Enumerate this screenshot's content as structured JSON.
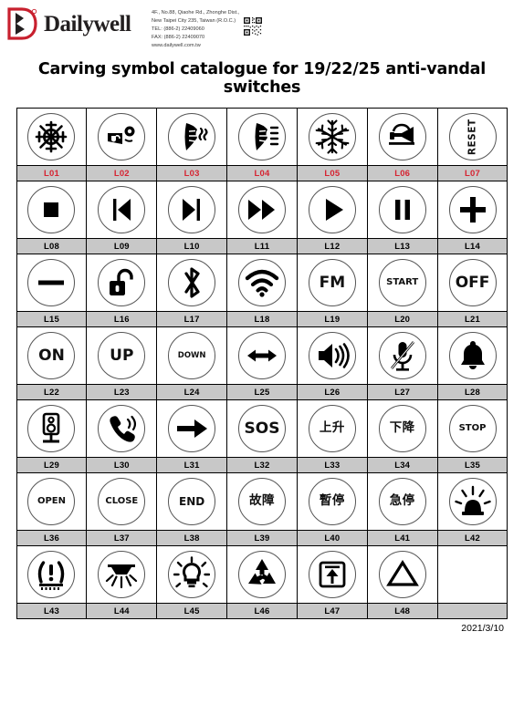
{
  "company": {
    "logo_name": "Dailywell",
    "address_lines": [
      "4F., No.88, Qiaohe Rd., Zhonghe Dist.,",
      "New Taipei City 235, Taiwan (R.O.C.)",
      "TEL: (886-2) 22409060",
      "FAX: (886-2) 22409070",
      "www.dailywell.com.tw"
    ]
  },
  "document": {
    "title": "Carving symbol catalogue for 19/22/25 anti-vandal switches",
    "date": "2021/3/10"
  },
  "colors": {
    "label_red": "#d62432",
    "label_black": "#000000",
    "label_row_bg": "#c8c8c8",
    "brand_red": "#c8202e"
  },
  "symbols": [
    {
      "code": "L01",
      "icon": "snowflake-ac-icon",
      "label_color": "red",
      "kind": "svg",
      "text": ""
    },
    {
      "code": "L02",
      "icon": "windshield-washer-icon",
      "label_color": "red",
      "kind": "svg",
      "text": ""
    },
    {
      "code": "L03",
      "icon": "rear-window-defroster-icon",
      "label_color": "red",
      "kind": "svg",
      "text": ""
    },
    {
      "code": "L04",
      "icon": "front-windshield-defroster-icon",
      "label_color": "red",
      "kind": "svg",
      "text": ""
    },
    {
      "code": "L05",
      "icon": "snowflake-icon",
      "label_color": "red",
      "kind": "svg",
      "text": ""
    },
    {
      "code": "L06",
      "icon": "horn-icon",
      "label_color": "red",
      "kind": "svg",
      "text": ""
    },
    {
      "code": "L07",
      "icon": "reset-text-icon",
      "label_color": "red",
      "kind": "rot",
      "text": "RESET"
    },
    {
      "code": "L08",
      "icon": "stop-square-icon",
      "label_color": "black",
      "kind": "svg",
      "text": ""
    },
    {
      "code": "L09",
      "icon": "previous-track-icon",
      "label_color": "black",
      "kind": "svg",
      "text": ""
    },
    {
      "code": "L10",
      "icon": "next-track-icon",
      "label_color": "black",
      "kind": "svg",
      "text": ""
    },
    {
      "code": "L11",
      "icon": "fast-forward-icon",
      "label_color": "black",
      "kind": "svg",
      "text": ""
    },
    {
      "code": "L12",
      "icon": "play-icon",
      "label_color": "black",
      "kind": "svg",
      "text": ""
    },
    {
      "code": "L13",
      "icon": "pause-icon",
      "label_color": "black",
      "kind": "svg",
      "text": ""
    },
    {
      "code": "L14",
      "icon": "plus-icon",
      "label_color": "black",
      "kind": "svg",
      "text": ""
    },
    {
      "code": "L15",
      "icon": "minus-icon",
      "label_color": "black",
      "kind": "svg",
      "text": ""
    },
    {
      "code": "L16",
      "icon": "unlock-padlock-icon",
      "label_color": "black",
      "kind": "svg",
      "text": ""
    },
    {
      "code": "L17",
      "icon": "bluetooth-icon",
      "label_color": "black",
      "kind": "svg",
      "text": ""
    },
    {
      "code": "L18",
      "icon": "wifi-icon",
      "label_color": "black",
      "kind": "svg",
      "text": ""
    },
    {
      "code": "L19",
      "icon": "fm-text-icon",
      "label_color": "black",
      "kind": "text",
      "text": "FM",
      "size": "t-xl"
    },
    {
      "code": "L20",
      "icon": "start-text-icon",
      "label_color": "black",
      "kind": "text",
      "text": "START",
      "size": "t-sm"
    },
    {
      "code": "L21",
      "icon": "off-text-icon",
      "label_color": "black",
      "kind": "text",
      "text": "OFF",
      "size": "t-xl"
    },
    {
      "code": "L22",
      "icon": "on-text-icon",
      "label_color": "black",
      "kind": "text",
      "text": "ON",
      "size": "t-xl"
    },
    {
      "code": "L23",
      "icon": "up-text-icon",
      "label_color": "black",
      "kind": "text",
      "text": "UP",
      "size": "t-xl"
    },
    {
      "code": "L24",
      "icon": "down-text-icon",
      "label_color": "black",
      "kind": "text",
      "text": "DOWN",
      "size": "t-xs"
    },
    {
      "code": "L25",
      "icon": "left-right-arrow-icon",
      "label_color": "black",
      "kind": "svg",
      "text": ""
    },
    {
      "code": "L26",
      "icon": "speaker-volume-icon",
      "label_color": "black",
      "kind": "svg",
      "text": ""
    },
    {
      "code": "L27",
      "icon": "microphone-mute-icon",
      "label_color": "black",
      "kind": "svg",
      "text": ""
    },
    {
      "code": "L28",
      "icon": "bell-icon",
      "label_color": "black",
      "kind": "svg",
      "text": ""
    },
    {
      "code": "L29",
      "icon": "loudspeaker-stand-icon",
      "label_color": "black",
      "kind": "svg",
      "text": ""
    },
    {
      "code": "L30",
      "icon": "phone-ringing-icon",
      "label_color": "black",
      "kind": "svg",
      "text": ""
    },
    {
      "code": "L31",
      "icon": "arrow-right-icon",
      "label_color": "black",
      "kind": "svg",
      "text": ""
    },
    {
      "code": "L32",
      "icon": "sos-text-icon",
      "label_color": "black",
      "kind": "text",
      "text": "SOS",
      "size": "t-xl"
    },
    {
      "code": "L33",
      "icon": "rise-cjk-text-icon",
      "label_color": "black",
      "kind": "text",
      "text": "上升",
      "size": "t-cjk"
    },
    {
      "code": "L34",
      "icon": "descend-cjk-text-icon",
      "label_color": "black",
      "kind": "text",
      "text": "下降",
      "size": "t-cjk"
    },
    {
      "code": "L35",
      "icon": "stop-text-icon",
      "label_color": "black",
      "kind": "text",
      "text": "STOP",
      "size": "t-sm"
    },
    {
      "code": "L36",
      "icon": "open-text-icon",
      "label_color": "black",
      "kind": "text",
      "text": "OPEN",
      "size": "t-sm"
    },
    {
      "code": "L37",
      "icon": "close-text-icon",
      "label_color": "black",
      "kind": "text",
      "text": "CLOSE",
      "size": "t-sm"
    },
    {
      "code": "L38",
      "icon": "end-text-icon",
      "label_color": "black",
      "kind": "text",
      "text": "END",
      "size": "t-md"
    },
    {
      "code": "L39",
      "icon": "fault-cjk-text-icon",
      "label_color": "black",
      "kind": "text",
      "text": "故障",
      "size": "t-cjk"
    },
    {
      "code": "L40",
      "icon": "pause-cjk-text-icon",
      "label_color": "black",
      "kind": "text",
      "text": "暫停",
      "size": "t-cjk"
    },
    {
      "code": "L41",
      "icon": "emergency-stop-cjk-text-icon",
      "label_color": "black",
      "kind": "text",
      "text": "急停",
      "size": "t-cjk"
    },
    {
      "code": "L42",
      "icon": "warning-beacon-light-icon",
      "label_color": "black",
      "kind": "svg",
      "text": ""
    },
    {
      "code": "L43",
      "icon": "tire-pressure-warning-icon",
      "label_color": "black",
      "kind": "svg",
      "text": ""
    },
    {
      "code": "L44",
      "icon": "ceiling-downlight-icon",
      "label_color": "black",
      "kind": "svg",
      "text": ""
    },
    {
      "code": "L45",
      "icon": "brightness-bulb-icon",
      "label_color": "black",
      "kind": "svg",
      "text": ""
    },
    {
      "code": "L46",
      "icon": "recycle-icon",
      "label_color": "black",
      "kind": "svg",
      "text": ""
    },
    {
      "code": "L47",
      "icon": "eject-boxed-arrow-icon",
      "label_color": "black",
      "kind": "svg",
      "text": ""
    },
    {
      "code": "L48",
      "icon": "triangle-icon",
      "label_color": "black",
      "kind": "svg",
      "text": ""
    },
    {
      "code": "",
      "icon": "empty-cell",
      "label_color": "black",
      "kind": "none",
      "text": ""
    }
  ]
}
